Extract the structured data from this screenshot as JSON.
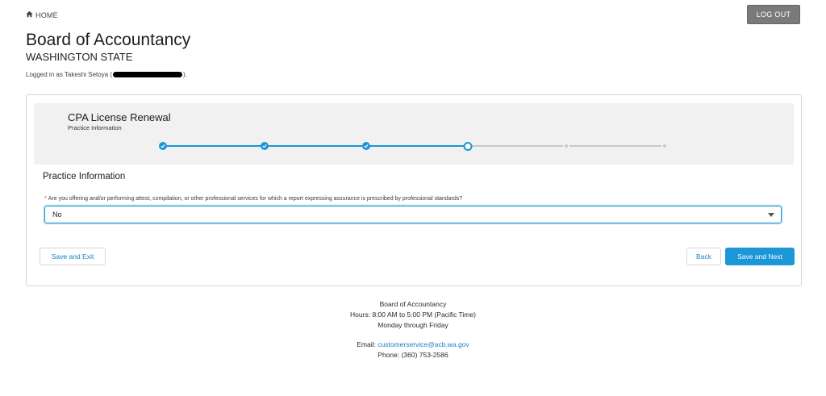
{
  "topbar": {
    "home_label": "HOME",
    "logout_label": "LOG OUT"
  },
  "header": {
    "title": "Board of Accountancy",
    "subtitle": "WASHINGTON STATE",
    "logged_prefix": "Logged in as Takeshi Setoya (",
    "logged_suffix": ")."
  },
  "form": {
    "title": "CPA License Renewal",
    "subtitle": "Practice Information",
    "progress": {
      "total_steps": 6,
      "completed_steps": 3,
      "current_step": 4
    },
    "section_title": "Practice Information",
    "question": {
      "required_marker": "*",
      "text": "Are you offering and/or performing attest, compilation, or other professional services for which a report expressing assurance is prescribed by professional standards?",
      "selected_value": "No"
    },
    "buttons": {
      "save_exit": "Save and Exit",
      "back": "Back",
      "save_next": "Save and Next"
    }
  },
  "footer": {
    "org": "Board of Accountancy",
    "hours": "Hours: 8:00 AM to 5:00 PM (Pacific Time)",
    "days": "Monday through Friday",
    "email_label": "Email: ",
    "email": "customerservice@acb.wa.gov",
    "phone": "Phone: (360) 753-2586"
  },
  "colors": {
    "accent": "#1b96d7",
    "logout_bg": "#7a7a7a",
    "required": "#c23934",
    "link": "#1b7fc4"
  },
  "icons": {
    "home": "home-icon",
    "step_done": "check-icon",
    "dropdown": "chevron-down-icon"
  }
}
